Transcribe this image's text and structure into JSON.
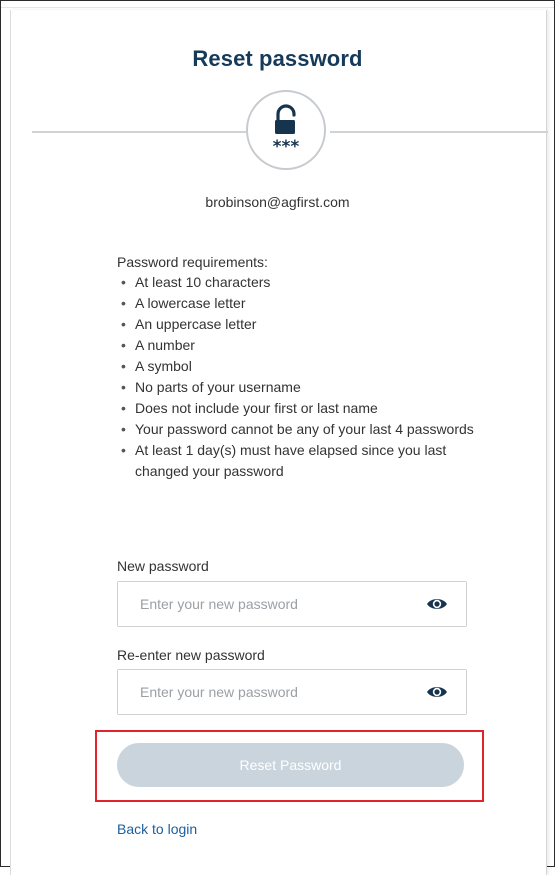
{
  "page": {
    "title": "Reset password",
    "email": "brobinson@agfirst.com"
  },
  "requirements": {
    "heading": "Password requirements:",
    "items": [
      "At least 10 characters",
      "A lowercase letter",
      "An uppercase letter",
      "A number",
      "A symbol",
      "No parts of your username",
      "Does not include your first or last name",
      "Your password cannot be any of your last 4 passwords",
      "At least 1 day(s) must have elapsed since you last changed your password"
    ]
  },
  "form": {
    "new_password": {
      "label": "New password",
      "placeholder": "Enter your new password",
      "value": ""
    },
    "confirm_password": {
      "label": "Re-enter new password",
      "placeholder": "Enter your new password",
      "value": ""
    },
    "submit_label": "Reset Password",
    "back_label": "Back to login"
  },
  "icons": {
    "header": "unlocked-padlock-password-icon",
    "field_toggle": "eye-icon"
  },
  "colors": {
    "title": "#163a5a",
    "link": "#1b5f9d",
    "button_disabled": "#c9d4dc",
    "highlight": "#e0242b"
  }
}
